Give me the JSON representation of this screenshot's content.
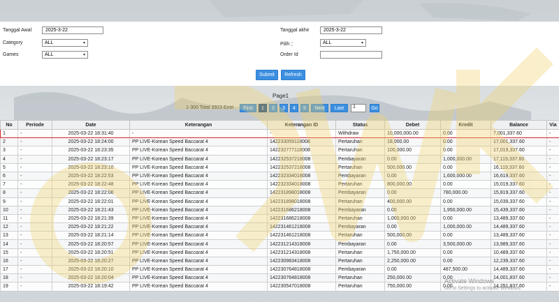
{
  "filters": {
    "tanggal_awal_label": "Tanggal Awal",
    "tanggal_awal_value": "2025-3-22",
    "tanggal_akhir_label": "Tanggal akhir",
    "tanggal_akhir_value": "2025-3-22",
    "category_label": "Category",
    "category_value": "ALL",
    "pilih_label": "Pilih ：",
    "pilih_value": "ALL",
    "games_label": "Games",
    "games_value": "ALL",
    "order_id_label": "Order Id",
    "order_id_value": "",
    "submit_label": "Submit",
    "refresh_label": "Refresh"
  },
  "pager": {
    "title": "Page1",
    "total_text": "1-300 Total 3923 Entri",
    "first": "First",
    "pages": [
      "1",
      "2",
      "3",
      "4",
      "5"
    ],
    "next": "Next",
    "last": "Last",
    "page_input": "1",
    "go": "Go"
  },
  "table": {
    "headers": [
      "No",
      "Periode",
      "Date",
      "Keterangan",
      "Keterangan ID",
      "Status",
      "Debet",
      "Kredit",
      "Balance",
      "Via"
    ],
    "rows": [
      [
        "1",
        "-",
        "2025-03-22 18:31:40",
        "-",
        "-",
        "Withdraw",
        "10,000,000.00",
        "0.00",
        "7,001,337.60",
        "-"
      ],
      [
        "2",
        "-",
        "2025-03-22 18:24:00",
        "PP LIVE-Korean Speed Baccarat 4",
        "142233059118008",
        "Pertaruhan",
        "18,000.00",
        "0.00",
        "17,001,337.60",
        "-"
      ],
      [
        "3",
        "-",
        "2025-03-22 18:23:35",
        "PP LIVE-Korean Speed Baccarat 4",
        "142232777118008",
        "Pertaruhan",
        "100,000.00",
        "0.00",
        "17,019,337.60",
        "-"
      ],
      [
        "4",
        "-",
        "2025-03-22 18:23:17",
        "PP LIVE-Korean Speed Baccarat 4",
        "142232537218008",
        "Pembayaran",
        "0.00",
        "1,000,000.00",
        "17,119,337.60",
        "-"
      ],
      [
        "5",
        "-",
        "2025-03-22 18:23:10",
        "PP LIVE-Korean Speed Baccarat 4",
        "142232537218008",
        "Pertaruhan",
        "500,000.00",
        "0.00",
        "16,119,337.60",
        "-"
      ],
      [
        "6",
        "-",
        "2025-03-22 18:22:53",
        "PP LIVE-Korean Speed Baccarat 4",
        "142232334018008",
        "Pembayaran",
        "0.00",
        "1,600,000.00",
        "16,619,337.60",
        "-"
      ],
      [
        "7",
        "-",
        "2025-03-22 18:22:48",
        "PP LIVE-Korean Speed Baccarat 4",
        "142232334018008",
        "Pertaruhan",
        "800,000.00",
        "0.00",
        "15,019,337.60",
        "-"
      ],
      [
        "8",
        "-",
        "2025-03-22 18:22:06",
        "PP LIVE-Korean Speed Baccarat 4",
        "142231898018008",
        "Pembayaran",
        "0.00",
        "780,000.00",
        "15,819,337.60",
        "-"
      ],
      [
        "9",
        "-",
        "2025-03-22 18:22:01",
        "PP LIVE-Korean Speed Baccarat 4",
        "142231898018008",
        "Pertaruhan",
        "400,000.00",
        "0.00",
        "15,039,337.60",
        "-"
      ],
      [
        "10",
        "-",
        "2025-03-22 18:21:43",
        "PP LIVE-Korean Speed Baccarat 4",
        "142231686218008",
        "Pembayaran",
        "0.00",
        "1,950,000.00",
        "15,439,337.60",
        "-"
      ],
      [
        "11",
        "-",
        "2025-03-22 18:21:39",
        "PP LIVE-Korean Speed Baccarat 4",
        "142231686218008",
        "Pertaruhan",
        "1,000,000.00",
        "0.00",
        "13,489,337.60",
        "-"
      ],
      [
        "12",
        "-",
        "2025-03-22 18:21:22",
        "PP LIVE-Korean Speed Baccarat 4",
        "142231461218008",
        "Pembayaran",
        "0.00",
        "1,000,000.00",
        "14,489,337.60",
        "-"
      ],
      [
        "13",
        "-",
        "2025-03-22 18:21:14",
        "PP LIVE-Korean Speed Baccarat 4",
        "142231461218008",
        "Pertaruhan",
        "500,000.00",
        "0.00",
        "13,489,337.60",
        "-"
      ],
      [
        "14",
        "-",
        "2025-03-22 18:20:57",
        "PP LIVE-Korean Speed Baccarat 4",
        "142231214318008",
        "Pembayaran",
        "0.00",
        "3,500,000.00",
        "13,989,337.60",
        "-"
      ],
      [
        "15",
        "-",
        "2025-03-22 18:20:51",
        "PP LIVE-Korean Speed Baccarat 4",
        "142231214318008",
        "Pertaruhan",
        "1,750,000.00",
        "0.00",
        "10,489,337.60",
        "-"
      ],
      [
        "16",
        "-",
        "2025-03-22 18:20:27",
        "PP LIVE-Korean Speed Baccarat 4",
        "142230983418008",
        "Pertaruhan",
        "2,250,000.00",
        "0.00",
        "12,239,337.60",
        "-"
      ],
      [
        "17",
        "-",
        "2025-03-22 18:20:10",
        "PP LIVE-Korean Speed Baccarat 4",
        "142230764818008",
        "Pembayaran",
        "0.00",
        "487,500.00",
        "14,489,337.60",
        "-"
      ],
      [
        "18",
        "-",
        "2025-03-22 18:20:04",
        "PP LIVE-Korean Speed Baccarat 4",
        "142230764818008",
        "Pertaruhan",
        "250,000.00",
        "0.00",
        "14,001,837.60",
        "-"
      ],
      [
        "19",
        "-",
        "2025-03-22 18:19:42",
        "PP LIVE-Korean Speed Baccarat 4",
        "142230547018008",
        "Pertaruhan",
        "750,000.00",
        "0.00",
        "14,251,837.60",
        "-"
      ]
    ]
  },
  "overlay": {
    "activate_title": "Activate Windows",
    "activate_sub": "Go to Settings to activate Windows."
  },
  "colors": {
    "accent": "#3c8fe0",
    "highlight": "#d9262a",
    "link": "#2f7fd0"
  }
}
